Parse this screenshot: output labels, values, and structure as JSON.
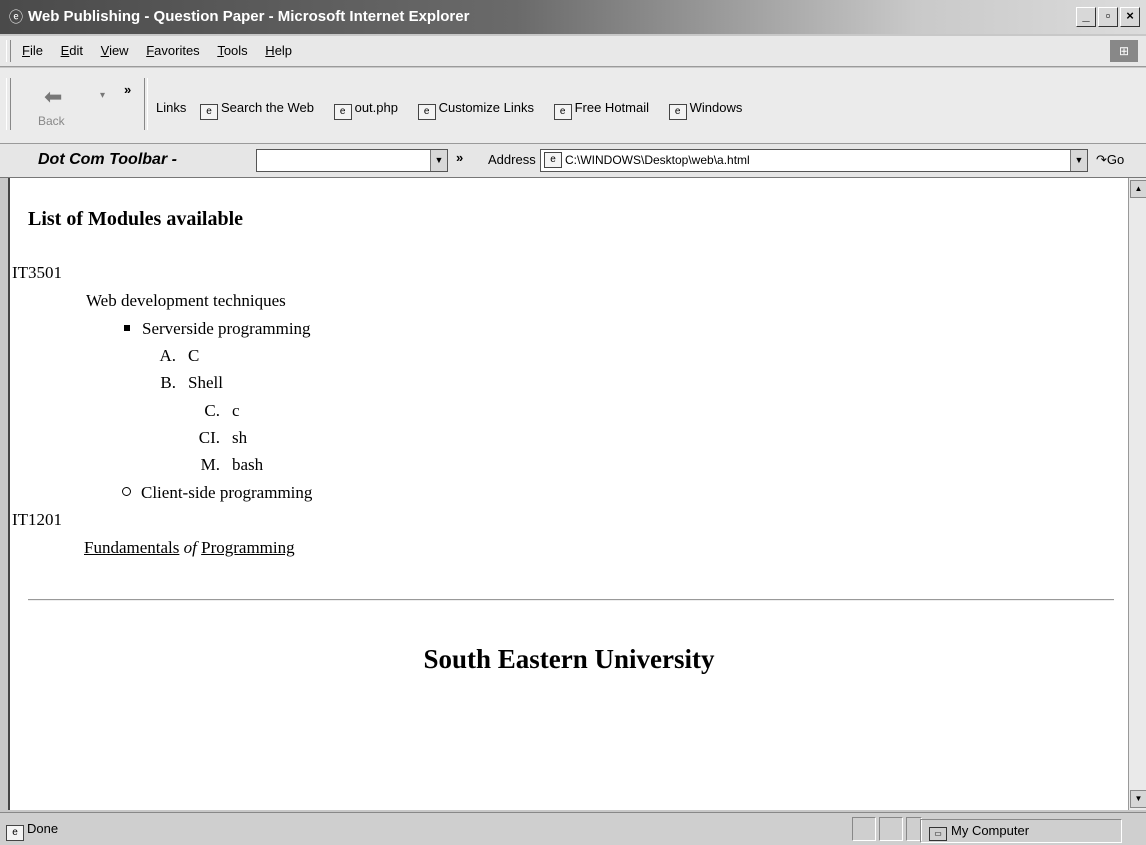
{
  "window": {
    "title": "Web Publishing - Question Paper - Microsoft Internet Explorer",
    "buttons": [
      "_",
      " ",
      "×"
    ]
  },
  "menubar": {
    "items": [
      "File",
      "Edit",
      "View",
      "Favorites",
      "Tools",
      "Help"
    ]
  },
  "navbar": {
    "back_label": "Back",
    "links_label": "Links",
    "links": [
      "Search the Web",
      "out.php",
      "Customize Links",
      "Free Hotmail",
      "Windows"
    ]
  },
  "addressbar": {
    "dotcom_label": "Dot Com Toolbar -",
    "address_label": "Address",
    "address_value": "C:\\WINDOWS\\Desktop\\web\\a.html",
    "go_label": "Go"
  },
  "page": {
    "heading": "List of Modules available",
    "items": {
      "m1_code": "IT3501",
      "m1_title": "Web development techniques",
      "server_side": "Serverside programming",
      "list_a_markers": [
        "A.",
        "B."
      ],
      "list_a_items": [
        "C",
        "Shell"
      ],
      "list_b_markers": [
        "C.",
        "CI.",
        "M."
      ],
      "list_b_items": [
        "c",
        "sh",
        "bash"
      ],
      "client_side": "Client-side programming",
      "m2_code": "IT1201",
      "m2_title_part1": "Fundamentals",
      "m2_title_part2": "of",
      "m2_title_part3": "Programming"
    },
    "university": "South Eastern University"
  },
  "statusbar": {
    "status": "Done",
    "zone": "My Computer"
  }
}
